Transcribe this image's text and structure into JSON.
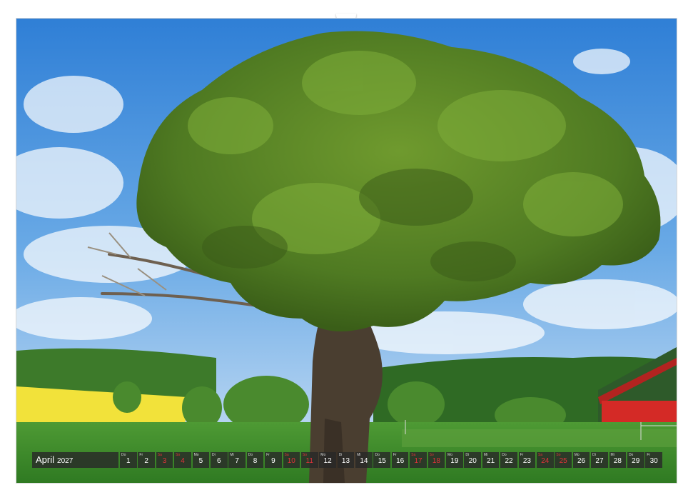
{
  "calendar": {
    "month": "April",
    "year": "2027",
    "days": [
      {
        "wd": "Do",
        "n": "1",
        "red": false
      },
      {
        "wd": "Fr",
        "n": "2",
        "red": false
      },
      {
        "wd": "Sa",
        "n": "3",
        "red": true
      },
      {
        "wd": "So",
        "n": "4",
        "red": true
      },
      {
        "wd": "Mo",
        "n": "5",
        "red": false
      },
      {
        "wd": "Di",
        "n": "6",
        "red": false
      },
      {
        "wd": "Mi",
        "n": "7",
        "red": false
      },
      {
        "wd": "Do",
        "n": "8",
        "red": false
      },
      {
        "wd": "Fr",
        "n": "9",
        "red": false
      },
      {
        "wd": "Sa",
        "n": "10",
        "red": true
      },
      {
        "wd": "So",
        "n": "11",
        "red": true
      },
      {
        "wd": "Mo",
        "n": "12",
        "red": false
      },
      {
        "wd": "Di",
        "n": "13",
        "red": false
      },
      {
        "wd": "Mi",
        "n": "14",
        "red": false
      },
      {
        "wd": "Do",
        "n": "15",
        "red": false
      },
      {
        "wd": "Fr",
        "n": "16",
        "red": false
      },
      {
        "wd": "Sa",
        "n": "17",
        "red": true
      },
      {
        "wd": "So",
        "n": "18",
        "red": true
      },
      {
        "wd": "Mo",
        "n": "19",
        "red": false
      },
      {
        "wd": "Di",
        "n": "20",
        "red": false
      },
      {
        "wd": "Mi",
        "n": "21",
        "red": false
      },
      {
        "wd": "Do",
        "n": "22",
        "red": false
      },
      {
        "wd": "Fr",
        "n": "23",
        "red": false
      },
      {
        "wd": "Sa",
        "n": "24",
        "red": true
      },
      {
        "wd": "So",
        "n": "25",
        "red": true
      },
      {
        "wd": "Mo",
        "n": "26",
        "red": false
      },
      {
        "wd": "Di",
        "n": "27",
        "red": false
      },
      {
        "wd": "Mi",
        "n": "28",
        "red": false
      },
      {
        "wd": "Do",
        "n": "29",
        "red": false
      },
      {
        "wd": "Fr",
        "n": "30",
        "red": false
      }
    ]
  },
  "colors": {
    "sky": "#3f8fdc",
    "rapeseed": "#f2e23a",
    "barn": "#d42a26",
    "grass": "#3f8a2a",
    "holiday": "#e0323a"
  }
}
